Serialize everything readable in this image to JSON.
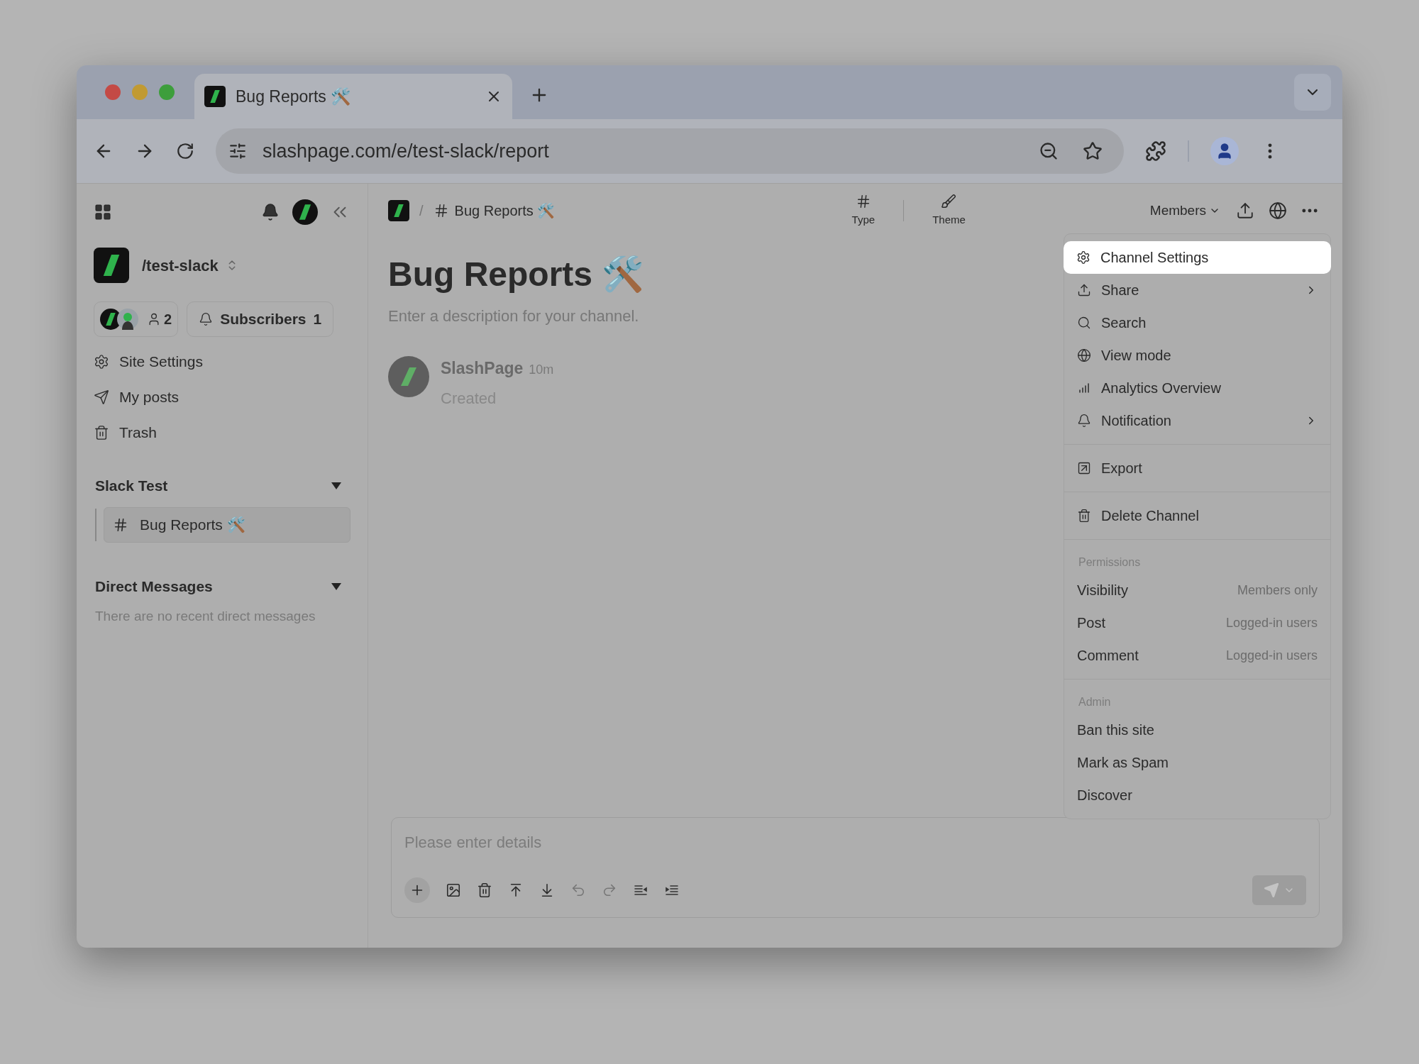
{
  "browser": {
    "tab": {
      "title": "Bug Reports 🛠️",
      "selected": true
    },
    "address": "slashpage.com/e/test-slack/report"
  },
  "sidebar": {
    "site_name": "/test-slack",
    "members_count": "2",
    "subscribers": {
      "label": "Subscribers",
      "count": "1"
    },
    "nav_items": [
      {
        "label": "Site Settings"
      },
      {
        "label": "My posts"
      },
      {
        "label": "Trash"
      }
    ],
    "sections": [
      {
        "title": "Slack Test",
        "expanded": true,
        "channels": [
          {
            "name": "Bug Reports 🛠️",
            "selected": true
          }
        ]
      },
      {
        "title": "Direct Messages",
        "expanded": true,
        "empty_text": "There are no recent direct messages"
      }
    ]
  },
  "header": {
    "separator": "/",
    "breadcrumb": "Bug Reports 🛠️",
    "tools": [
      {
        "label": "Type"
      },
      {
        "label": "Theme"
      }
    ],
    "members_button": "Members"
  },
  "channel": {
    "title": "Bug Reports 🛠️",
    "description_placeholder": "Enter a description for your channel.",
    "post": {
      "author": "SlashPage",
      "time": "10m",
      "text": "Created"
    }
  },
  "menu": {
    "groups": [
      {
        "items": [
          {
            "label": "Channel Settings",
            "selected": true,
            "submenu": false
          },
          {
            "label": "Share",
            "selected": false,
            "submenu": true
          },
          {
            "label": "Search",
            "selected": false,
            "submenu": false
          },
          {
            "label": "View mode",
            "selected": false,
            "submenu": false
          },
          {
            "label": "Analytics Overview",
            "selected": false,
            "submenu": false
          },
          {
            "label": "Notification",
            "selected": false,
            "submenu": true
          }
        ]
      },
      {
        "items": [
          {
            "label": "Export",
            "selected": false,
            "submenu": false
          }
        ]
      },
      {
        "items": [
          {
            "label": "Delete Channel",
            "selected": false,
            "submenu": false
          }
        ]
      },
      {
        "heading": "Permissions",
        "items": [
          {
            "label": "Visibility",
            "value": "Members only",
            "selected": false
          },
          {
            "label": "Post",
            "value": "Logged-in users",
            "selected": false
          },
          {
            "label": "Comment",
            "value": "Logged-in users",
            "selected": false
          }
        ]
      },
      {
        "heading": "Admin",
        "items": [
          {
            "label": "Ban this site",
            "selected": false
          },
          {
            "label": "Mark as Spam",
            "selected": false
          },
          {
            "label": "Discover",
            "selected": false
          }
        ]
      }
    ]
  },
  "composer": {
    "placeholder": "Please enter details"
  }
}
